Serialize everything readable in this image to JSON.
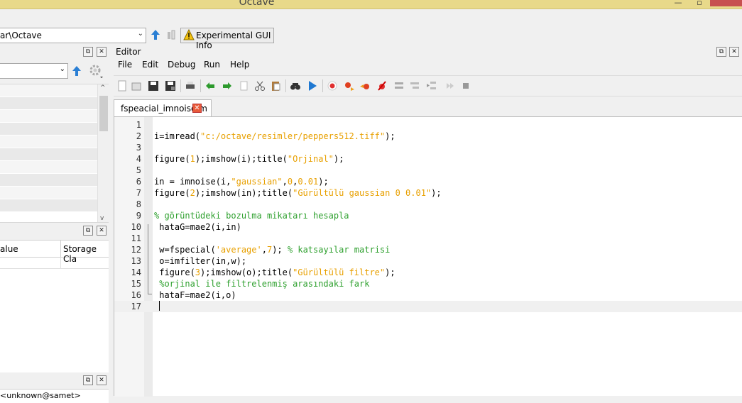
{
  "window": {
    "title": "Octave"
  },
  "dirbar": {
    "path": "ar\\Octave",
    "gui_info_label": "Experimental GUI Info"
  },
  "workspace": {
    "col_value": "alue",
    "col_storage": "Storage Cla"
  },
  "command_history": {
    "first_line": "<unknown@samet>"
  },
  "editor": {
    "label": "Editor",
    "menus": [
      "File",
      "Edit",
      "Debug",
      "Run",
      "Help"
    ],
    "tab_name": "fspeacial_imnoise.m",
    "lines": [
      {
        "n": "1",
        "segs": []
      },
      {
        "n": "2",
        "segs": [
          {
            "t": "i=imread(",
            "c": "kw"
          },
          {
            "t": "\"c:/octave/resimler/peppers512.tiff\"",
            "c": "str"
          },
          {
            "t": ");",
            "c": "kw"
          }
        ]
      },
      {
        "n": "3",
        "segs": []
      },
      {
        "n": "4",
        "segs": [
          {
            "t": "figure(",
            "c": "kw"
          },
          {
            "t": "1",
            "c": "num"
          },
          {
            "t": ");imshow(i);title(",
            "c": "kw"
          },
          {
            "t": "\"Orjinal\"",
            "c": "str"
          },
          {
            "t": ");",
            "c": "kw"
          }
        ]
      },
      {
        "n": "5",
        "segs": []
      },
      {
        "n": "6",
        "segs": [
          {
            "t": "in = imnoise(i,",
            "c": "kw"
          },
          {
            "t": "\"gaussian\"",
            "c": "str"
          },
          {
            "t": ",",
            "c": "kw"
          },
          {
            "t": "0",
            "c": "num"
          },
          {
            "t": ",",
            "c": "kw"
          },
          {
            "t": "0.01",
            "c": "num"
          },
          {
            "t": ");",
            "c": "kw"
          }
        ]
      },
      {
        "n": "7",
        "segs": [
          {
            "t": "figure(",
            "c": "kw"
          },
          {
            "t": "2",
            "c": "num"
          },
          {
            "t": ");imshow(in);title(",
            "c": "kw"
          },
          {
            "t": "\"Gürültülü gaussian 0 0.01\"",
            "c": "str"
          },
          {
            "t": ");",
            "c": "kw"
          }
        ]
      },
      {
        "n": "8",
        "segs": []
      },
      {
        "n": "9",
        "segs": [
          {
            "t": "% görüntüdeki bozulma mikatarı hesapla",
            "c": "cmt"
          }
        ]
      },
      {
        "n": "10",
        "segs": [
          {
            "t": " hataG=mae2(i,in)",
            "c": "kw"
          }
        ]
      },
      {
        "n": "11",
        "segs": []
      },
      {
        "n": "12",
        "segs": [
          {
            "t": " w=fspecial(",
            "c": "kw"
          },
          {
            "t": "'average'",
            "c": "str"
          },
          {
            "t": ",",
            "c": "kw"
          },
          {
            "t": "7",
            "c": "num"
          },
          {
            "t": "); ",
            "c": "kw"
          },
          {
            "t": "% katsayılar matrisi",
            "c": "cmt"
          }
        ]
      },
      {
        "n": "13",
        "segs": [
          {
            "t": " o=imfilter(in,w);",
            "c": "kw"
          }
        ]
      },
      {
        "n": "14",
        "segs": [
          {
            "t": " figure(",
            "c": "kw"
          },
          {
            "t": "3",
            "c": "num"
          },
          {
            "t": ");imshow(o);title(",
            "c": "kw"
          },
          {
            "t": "\"Gürültülü filtre\"",
            "c": "str"
          },
          {
            "t": ");",
            "c": "kw"
          }
        ]
      },
      {
        "n": "15",
        "segs": [
          {
            "t": " %orjinal ile filtrelenmiş arasındaki fark",
            "c": "cmt"
          }
        ]
      },
      {
        "n": "16",
        "segs": [
          {
            "t": " hataF=mae2(i,o)",
            "c": "kw"
          }
        ]
      },
      {
        "n": "17",
        "segs": []
      }
    ]
  },
  "colors": {
    "string": "#e8a000",
    "comment": "#2ea02e",
    "titlebar": "#e8d98a"
  }
}
